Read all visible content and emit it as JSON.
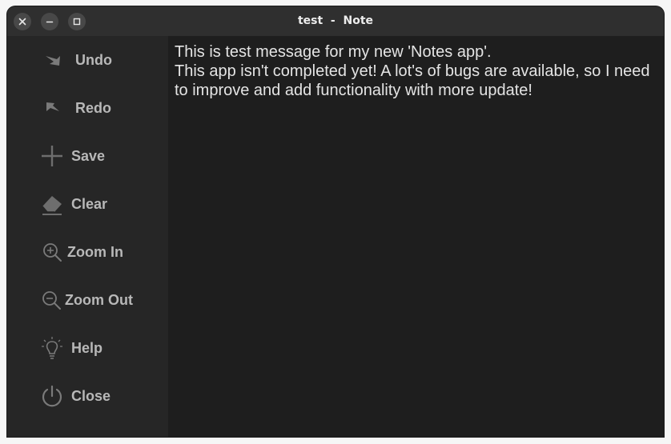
{
  "window": {
    "title": "test  -  Note"
  },
  "titlebar_buttons": {
    "close_icon": "close-icon",
    "minimize_icon": "minimize-icon",
    "maximize_icon": "maximize-icon"
  },
  "sidebar": {
    "items": [
      {
        "label": "Undo",
        "icon": "undo-icon"
      },
      {
        "label": "Redo",
        "icon": "redo-icon"
      },
      {
        "label": "Save",
        "icon": "plus-icon"
      },
      {
        "label": "Clear",
        "icon": "eraser-icon"
      },
      {
        "label": "Zoom In",
        "icon": "zoom-in-icon"
      },
      {
        "label": "Zoom Out",
        "icon": "zoom-out-icon"
      },
      {
        "label": "Help",
        "icon": "lightbulb-icon"
      },
      {
        "label": "Close",
        "icon": "power-icon"
      }
    ]
  },
  "editor": {
    "content": "This is test message for my new 'Notes app'.\nThis app isn't completed yet! A lot's of bugs are available, so I need to improve and add functionality with more update!"
  },
  "colors": {
    "titlebar_bg": "#2f2f2f",
    "sidebar_bg": "#262626",
    "editor_bg": "#1e1e1e",
    "text": "#e4e4e4",
    "label": "#b8b8b8"
  }
}
